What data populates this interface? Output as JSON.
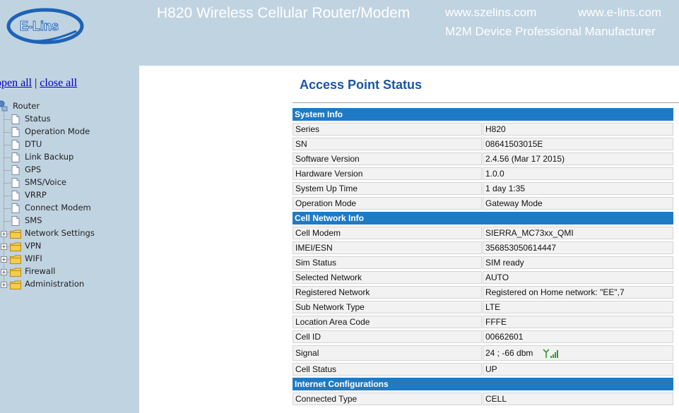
{
  "header": {
    "logo_text": "E-Lins",
    "title": "H820 Wireless Cellular Router/Modem",
    "url1": "www.szelins.com",
    "url2": "www.e-lins.com",
    "tagline": "M2M Device Professional Manufacturer"
  },
  "sidebar": {
    "open_all": "open all",
    "separator": "|",
    "close_all": "close all",
    "root": "Router",
    "pages": [
      "Status",
      "Operation Mode",
      "DTU",
      "Link Backup",
      "GPS",
      "SMS/Voice",
      "VRRP",
      "Connect Modem",
      "SMS"
    ],
    "folders": [
      "Network Settings",
      "VPN",
      "WIFI",
      "Firewall",
      "Administration"
    ]
  },
  "main": {
    "title": "Access Point Status",
    "sections": [
      {
        "name": "System Info",
        "rows": [
          {
            "key": "Series",
            "value": "H820"
          },
          {
            "key": "SN",
            "value": "08641503015E"
          },
          {
            "key": "Software Version",
            "value": "2.4.56 (Mar 17 2015)"
          },
          {
            "key": "Hardware Version",
            "value": "1.0.0"
          },
          {
            "key": "System Up Time",
            "value": "1 day 1:35"
          },
          {
            "key": "Operation Mode",
            "value": "Gateway Mode"
          }
        ]
      },
      {
        "name": "Cell Network Info",
        "rows": [
          {
            "key": "Cell Modem",
            "value": "SIERRA_MC73xx_QMI"
          },
          {
            "key": "IMEI/ESN",
            "value": "356853050614447"
          },
          {
            "key": "Sim Status",
            "value": "SIM ready"
          },
          {
            "key": "Selected Network",
            "value": "AUTO"
          },
          {
            "key": "Registered Network",
            "value": "Registered on Home network: \"EE\",7"
          },
          {
            "key": "Sub Network Type",
            "value": "LTE"
          },
          {
            "key": "Location Area Code",
            "value": "FFFE"
          },
          {
            "key": "Cell ID",
            "value": "00662601"
          },
          {
            "key": "Signal",
            "value": "24 ; -66 dbm",
            "icon": "signal-strength-icon"
          },
          {
            "key": "Cell Status",
            "value": "UP"
          }
        ]
      },
      {
        "name": "Internet Configurations",
        "rows": [
          {
            "key": "Connected Type",
            "value": "CELL"
          }
        ]
      }
    ]
  },
  "colors": {
    "background": "#c0d3e1",
    "section_header": "#1f7ac4",
    "title": "#1a56a8",
    "link": "#0000cc",
    "signal_icon": "#2a9d2a"
  }
}
